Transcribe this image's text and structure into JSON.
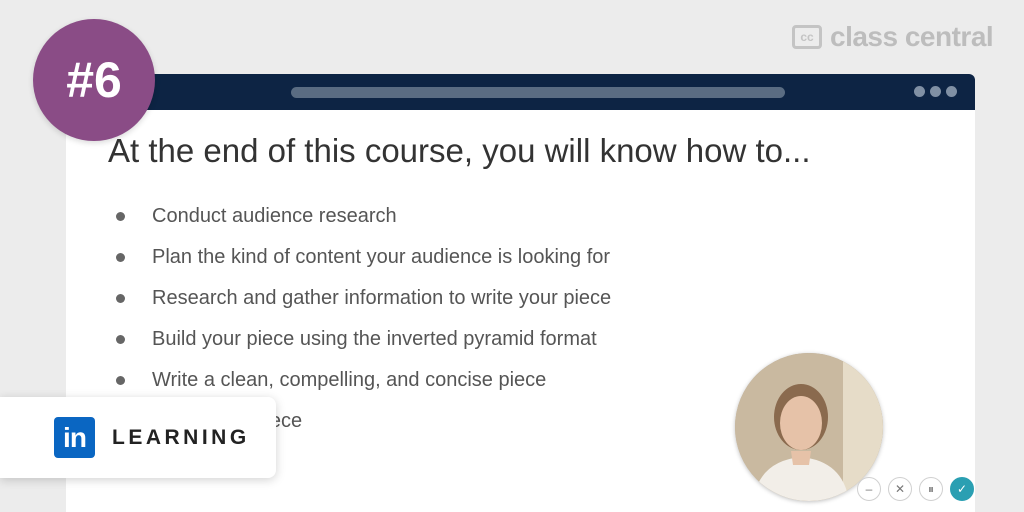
{
  "badge": {
    "text": "#6"
  },
  "brand": {
    "mark": "cc",
    "name": "class central"
  },
  "slide": {
    "title": "At the end of this course, you will know how to...",
    "bullets": [
      "Conduct audience research",
      "Plan the kind of content your audience is looking for",
      "Research and gather information to write your piece",
      "Build your piece using the inverted pyramid format",
      "Write a clean, compelling, and concise piece",
      "check your piece",
      "iece"
    ]
  },
  "linkedin": {
    "logo": "in",
    "label": "LEARNING"
  },
  "controls": [
    {
      "icon": "minus-icon",
      "glyph": "–"
    },
    {
      "icon": "close-icon",
      "glyph": "✕"
    },
    {
      "icon": "pause-icon",
      "glyph": "⏸"
    },
    {
      "icon": "check-icon",
      "glyph": "✓"
    }
  ],
  "colors": {
    "badge": "#8a4c86",
    "window_bar": "#0d2444",
    "linkedin_blue": "#0a66c2",
    "control_active": "#2a9fb2"
  }
}
